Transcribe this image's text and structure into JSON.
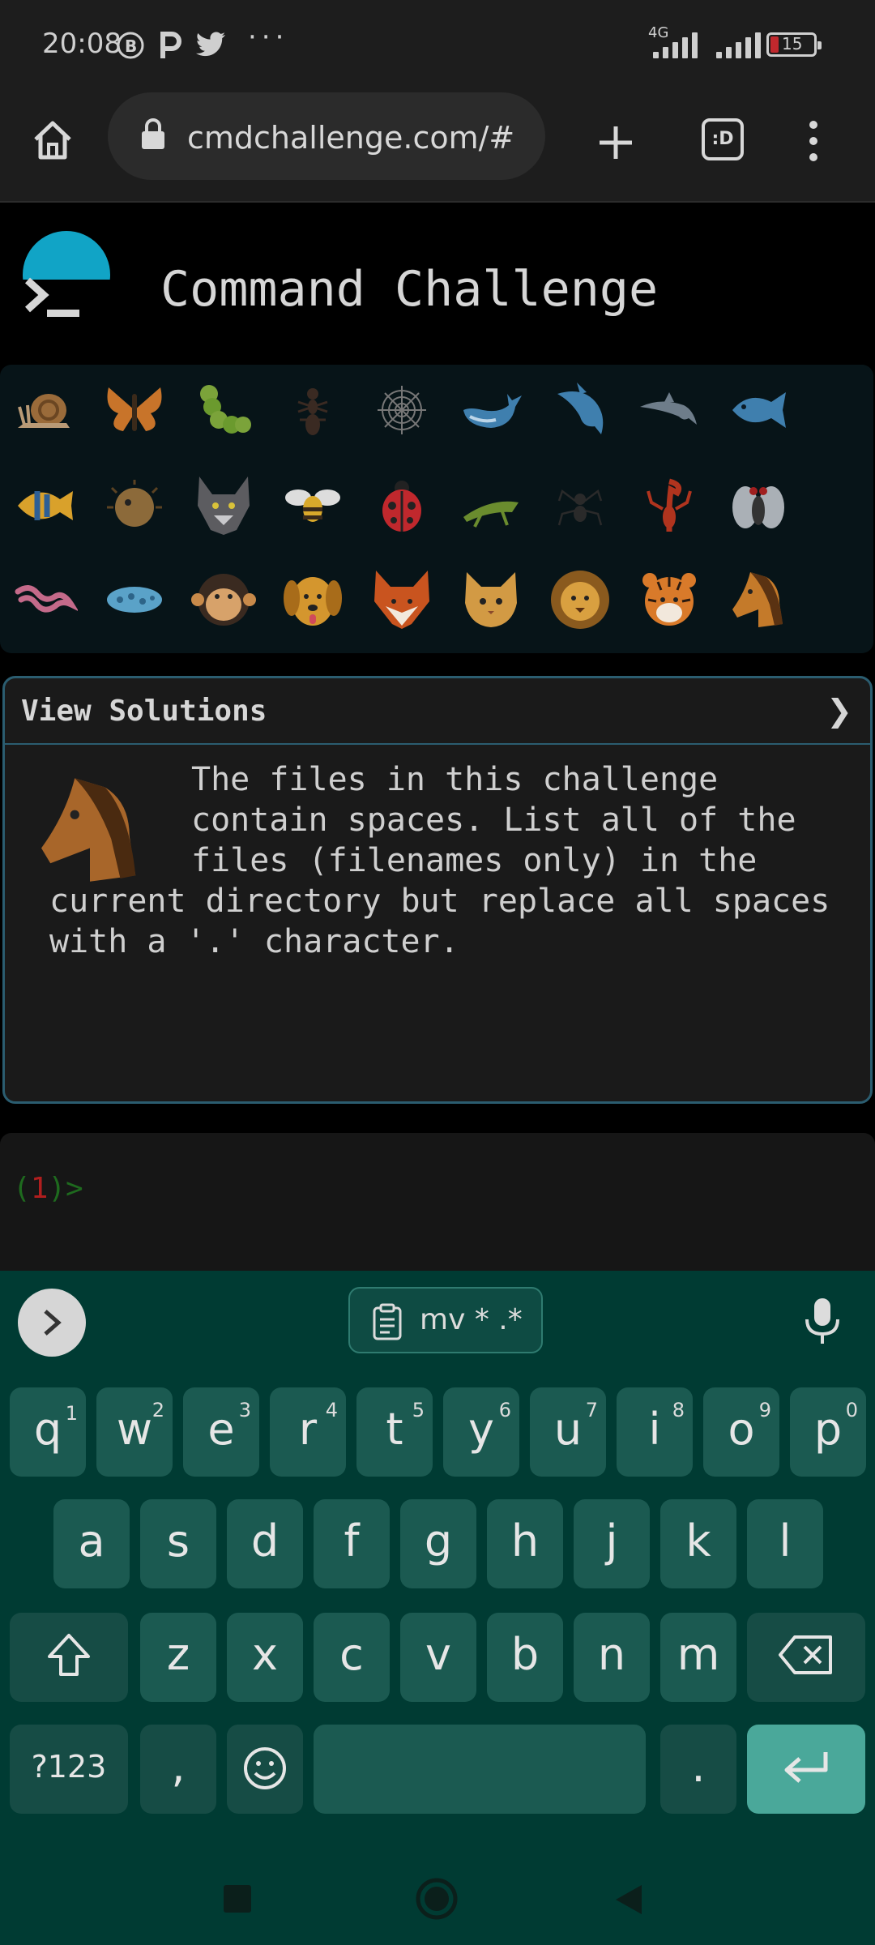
{
  "status_bar": {
    "time": "20:08",
    "icons": [
      "b-circle-icon",
      "parking-icon",
      "twitter-icon"
    ],
    "more": "···",
    "network": "4G",
    "battery": "15"
  },
  "browser": {
    "url": "cmdchallenge.com/#",
    "tab_count": ":D"
  },
  "page": {
    "title": "Command Challenge",
    "animals_row1": [
      "snail",
      "butterfly",
      "caterpillar",
      "ant",
      "spider-web",
      "whale",
      "dolphin",
      "dolphin-2",
      "fish"
    ],
    "animals_row2": [
      "tropical-fish",
      "blowfish",
      "wolf",
      "bee",
      "ladybug",
      "cricket",
      "spider",
      "scorpion",
      "fly"
    ],
    "animals_row3": [
      "worm",
      "microbe",
      "monkey",
      "dog",
      "fox",
      "cat",
      "lion",
      "tiger",
      "horse"
    ],
    "solutions_label": "View Solutions",
    "solutions_chevron": "❯",
    "challenge_text": "The files in this challenge contain spaces. List all of the files (filenames only) in the current directory but replace all spaces with a '.' character.",
    "prompt_open": "(",
    "prompt_number": "1",
    "prompt_close": ")>"
  },
  "keyboard": {
    "clipboard_suggestion": "mv * .*",
    "row1": [
      {
        "k": "q",
        "s": "1"
      },
      {
        "k": "w",
        "s": "2"
      },
      {
        "k": "e",
        "s": "3"
      },
      {
        "k": "r",
        "s": "4"
      },
      {
        "k": "t",
        "s": "5"
      },
      {
        "k": "y",
        "s": "6"
      },
      {
        "k": "u",
        "s": "7"
      },
      {
        "k": "i",
        "s": "8"
      },
      {
        "k": "o",
        "s": "9"
      },
      {
        "k": "p",
        "s": "0"
      }
    ],
    "row2": [
      "a",
      "s",
      "d",
      "f",
      "g",
      "h",
      "j",
      "k",
      "l"
    ],
    "row3": [
      "z",
      "x",
      "c",
      "v",
      "b",
      "n",
      "m"
    ],
    "symbols_label": "?123",
    "comma_label": ",",
    "period_label": ".",
    "colors": {
      "key": "#1b5a51",
      "background": "#003b33",
      "enter": "#4aa89a"
    }
  }
}
